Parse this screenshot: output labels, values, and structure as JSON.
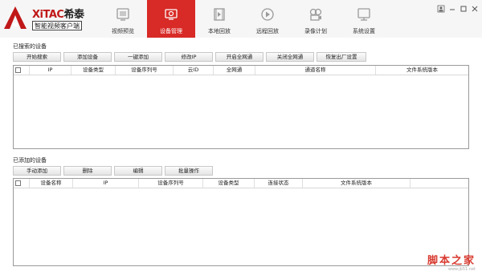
{
  "app": {
    "brand": "XiTAC",
    "brand_cn": "希泰",
    "subtitle": "智能视频客户端"
  },
  "nav": [
    {
      "label": "视频预览",
      "icon": "video-preview-icon",
      "active": false
    },
    {
      "label": "设备管理",
      "icon": "device-manage-icon",
      "active": true
    },
    {
      "label": "本地回放",
      "icon": "local-playback-icon",
      "active": false
    },
    {
      "label": "远程回放",
      "icon": "remote-playback-icon",
      "active": false
    },
    {
      "label": "录像计划",
      "icon": "record-plan-icon",
      "active": false
    },
    {
      "label": "系统设置",
      "icon": "system-settings-icon",
      "active": false
    }
  ],
  "searched": {
    "title": "已搜索的设备",
    "buttons": [
      "开始搜索",
      "添加设备",
      "一键添加",
      "修改IP",
      "开启全网通",
      "关闭全网通",
      "恢复出厂设置"
    ],
    "columns": [
      "IP",
      "设备类型",
      "设备序列号",
      "云ID",
      "全网通",
      "通道名称",
      "文件系统版本"
    ]
  },
  "added": {
    "title": "已添加的设备",
    "buttons": [
      "手动添加",
      "删除",
      "编辑",
      "批量操作"
    ],
    "columns": [
      "设备名称",
      "IP",
      "设备序列号",
      "设备类型",
      "连接状态",
      "文件系统版本"
    ]
  },
  "watermark": {
    "text": "脚本之家",
    "url": "www.jb51.net"
  },
  "colors": {
    "accent": "#d82a26",
    "brand_red": "#c01818"
  }
}
